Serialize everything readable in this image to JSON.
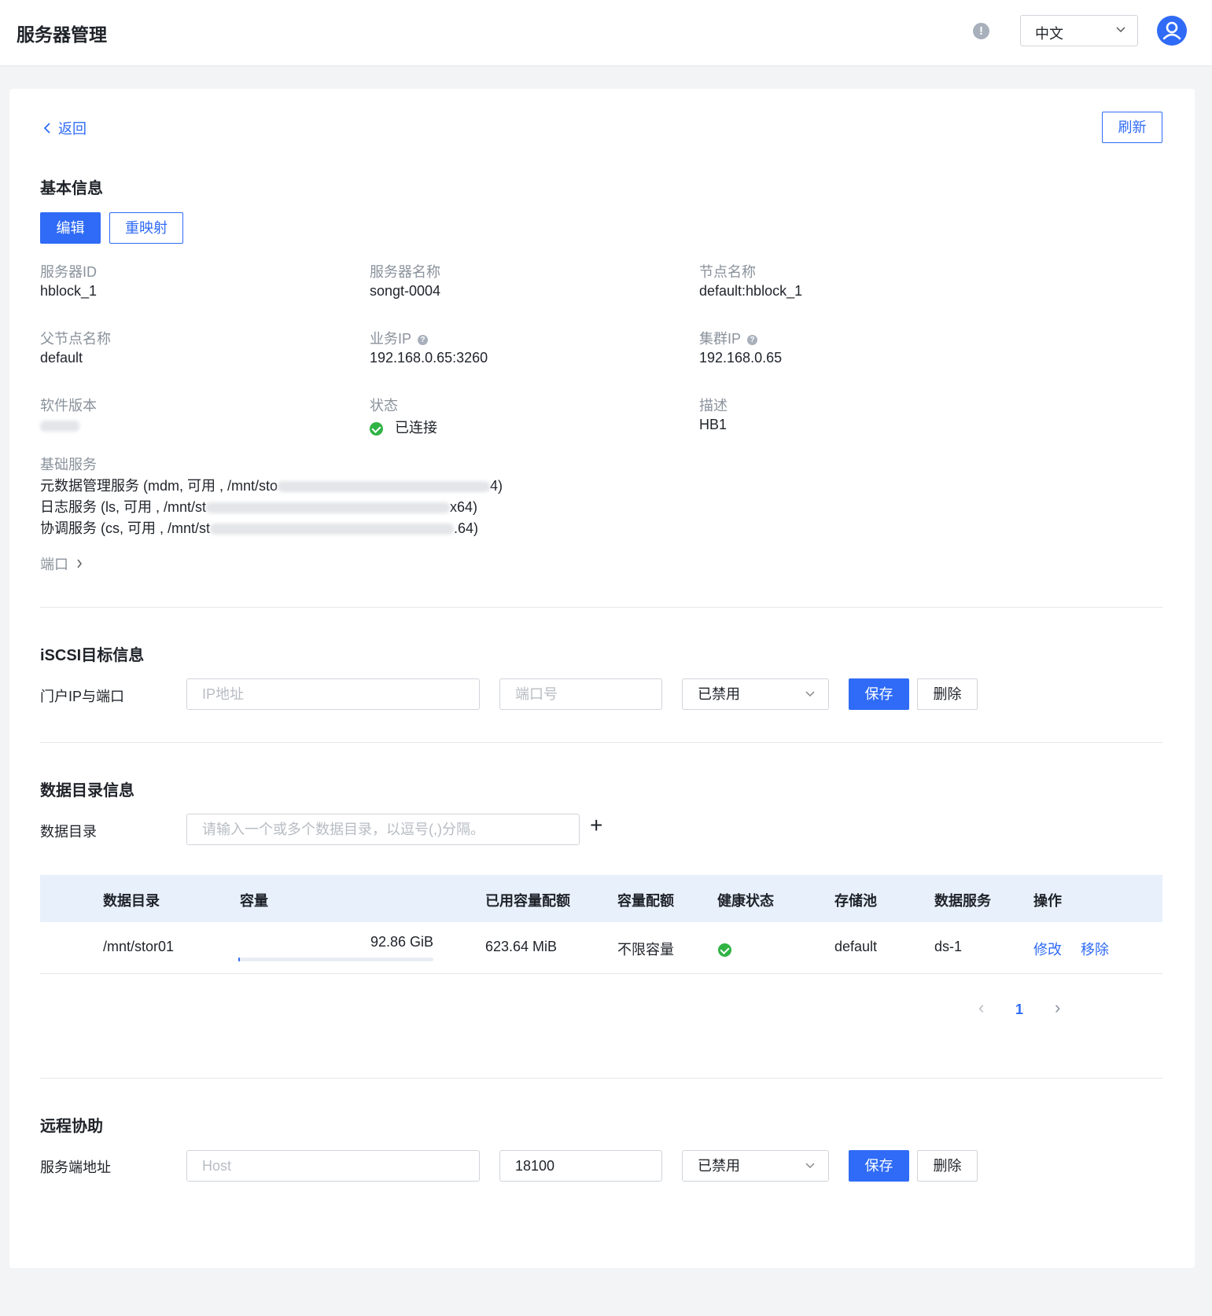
{
  "header": {
    "title": "服务器管理",
    "lang": "中文"
  },
  "toolbar": {
    "back": "返回",
    "refresh": "刷新"
  },
  "basic": {
    "title": "基本信息",
    "edit": "编辑",
    "remap": "重映射",
    "fields": {
      "server_id_label": "服务器ID",
      "server_id": "hblock_1",
      "server_name_label": "服务器名称",
      "server_name": "songt-0004",
      "node_name_label": "节点名称",
      "node_name": "default:hblock_1",
      "parent_node_label": "父节点名称",
      "parent_node": "default",
      "biz_ip_label": "业务IP",
      "biz_ip": "192.168.0.65:3260",
      "cluster_ip_label": "集群IP",
      "cluster_ip": "192.168.0.65",
      "sw_version_label": "软件版本",
      "status_label": "状态",
      "status": "已连接",
      "desc_label": "描述",
      "desc": "HB1",
      "base_services_label": "基础服务",
      "service_1_a": "元数据管理服务 (mdm, 可用 , /mnt/sto",
      "service_1_b": "4)",
      "service_2_a": "日志服务 (ls, 可用 , /mnt/st",
      "service_2_b": "x64)",
      "service_3_a": "协调服务 (cs, 可用 , /mnt/st",
      "service_3_b": ".64)",
      "ports_label": "端口"
    }
  },
  "iscsi": {
    "title": "iSCSI目标信息",
    "label": "门户IP与端口",
    "ip_placeholder": "IP地址",
    "port_placeholder": "端口号",
    "state": "已禁用",
    "save": "保存",
    "delete": "删除"
  },
  "datadir": {
    "title": "数据目录信息",
    "label": "数据目录",
    "placeholder": "请输入一个或多个数据目录，以逗号(,)分隔。",
    "add": "+",
    "columns": [
      "数据目录",
      "容量",
      "已用容量配额",
      "容量配额",
      "健康状态",
      "存储池",
      "数据服务",
      "操作"
    ],
    "rows": [
      {
        "dir": "/mnt/stor01",
        "capacity": "92.86 GiB",
        "capacity_used_fraction": 0.007,
        "used_quota": "623.64 MiB",
        "quota": "不限容量",
        "health": "ok",
        "pool": "default",
        "service": "ds-1",
        "action_edit": "修改",
        "action_remove": "移除"
      }
    ],
    "pagination": {
      "prev": "‹",
      "current": "1",
      "next": "›"
    }
  },
  "remote": {
    "title": "远程协助",
    "label": "服务端地址",
    "host_placeholder": "Host",
    "port": "18100",
    "state": "已禁用",
    "save": "保存",
    "delete": "删除"
  },
  "colors": {
    "accent": "#2f6bf6",
    "success": "#2fb344",
    "table_head": "#e8f0fb"
  }
}
